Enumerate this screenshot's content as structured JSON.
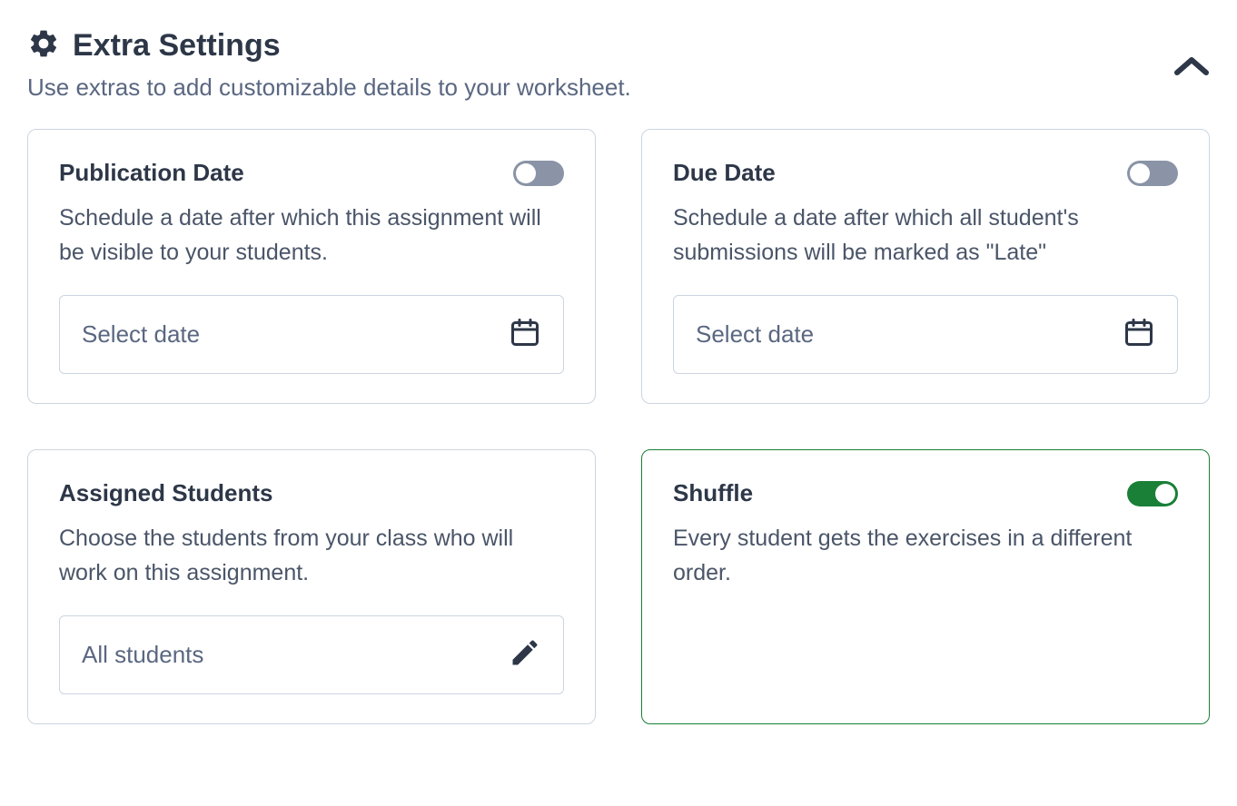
{
  "header": {
    "title": "Extra Settings",
    "subtitle": "Use extras to add customizable details to your worksheet."
  },
  "cards": {
    "publication_date": {
      "title": "Publication Date",
      "desc": "Schedule a date after which this assignment will be visible to your students.",
      "placeholder": "Select date",
      "toggle": false
    },
    "due_date": {
      "title": "Due Date",
      "desc": "Schedule a date after which all student's submissions will be marked as \"Late\"",
      "placeholder": "Select date",
      "toggle": false
    },
    "assigned_students": {
      "title": "Assigned Students",
      "desc": "Choose the students from your class who will work on this assignment.",
      "value": "All students"
    },
    "shuffle": {
      "title": "Shuffle",
      "desc": "Every student gets the exercises in a different order.",
      "toggle": true
    }
  }
}
